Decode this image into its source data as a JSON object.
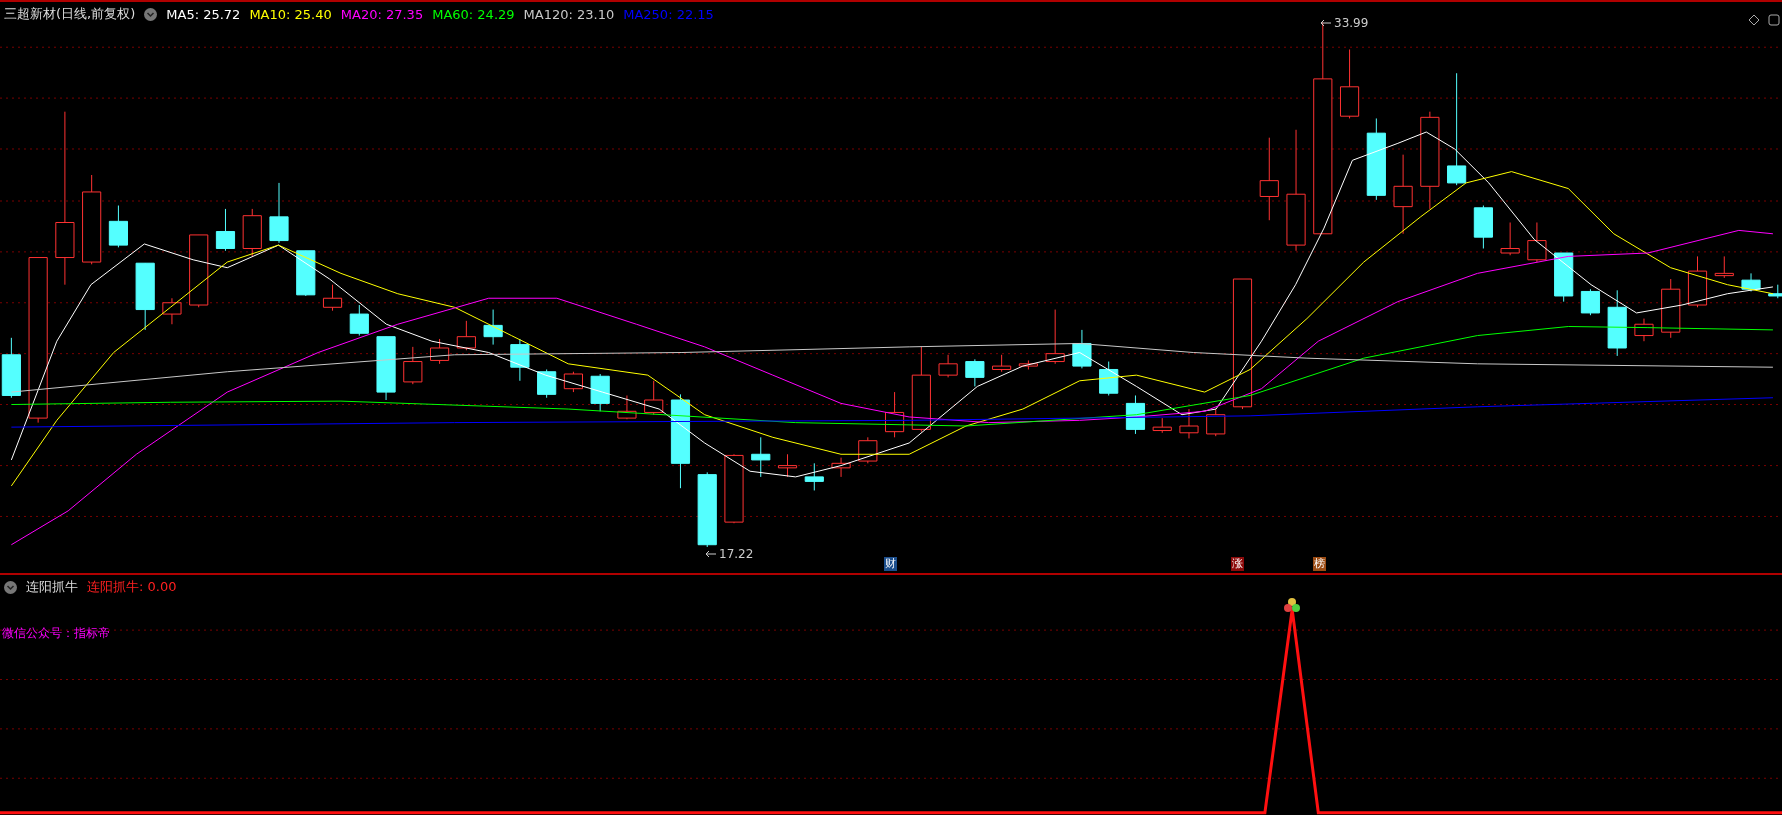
{
  "header": {
    "title": "三超新材(日线,前复权)",
    "ma": [
      {
        "label": "MA5: 25.72",
        "color": "#ffffff"
      },
      {
        "label": "MA10: 25.40",
        "color": "#ffff00"
      },
      {
        "label": "MA20: 27.35",
        "color": "#ff00ff"
      },
      {
        "label": "MA60: 24.29",
        "color": "#00ff00"
      },
      {
        "label": "MA120: 23.10",
        "color": "#c8c8c8"
      },
      {
        "label": "MA250: 22.15",
        "color": "#0000ff"
      }
    ]
  },
  "price_marks": [
    {
      "text": "33.99",
      "kind": "high"
    },
    {
      "text": "17.22",
      "kind": "low"
    }
  ],
  "event_tags": [
    {
      "text": "财",
      "color": "#1c4e8c"
    },
    {
      "text": "涨",
      "color": "#8c0a0a"
    },
    {
      "text": "榜",
      "color": "#9c4c14"
    }
  ],
  "indicator": {
    "title": "连阳抓牛",
    "reading": "连阳抓牛: 0.00",
    "note": "微信公众号：指标帝"
  }
}
